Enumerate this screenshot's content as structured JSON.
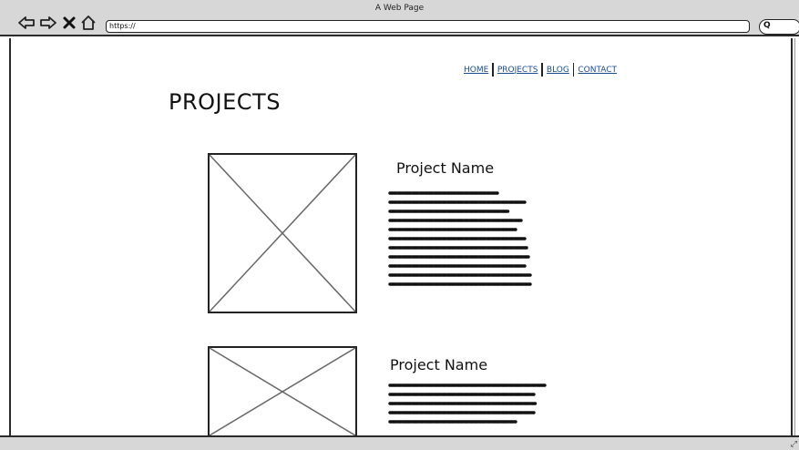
{
  "window": {
    "title": "A Web Page"
  },
  "browser": {
    "url": "https://"
  },
  "nav": {
    "items": [
      "HOME",
      "PROJECTS",
      "BLOG",
      "CONTACT"
    ]
  },
  "page": {
    "title": "PROJECTS"
  },
  "projects": [
    {
      "name": "Project Name"
    },
    {
      "name": "Project Name"
    }
  ]
}
